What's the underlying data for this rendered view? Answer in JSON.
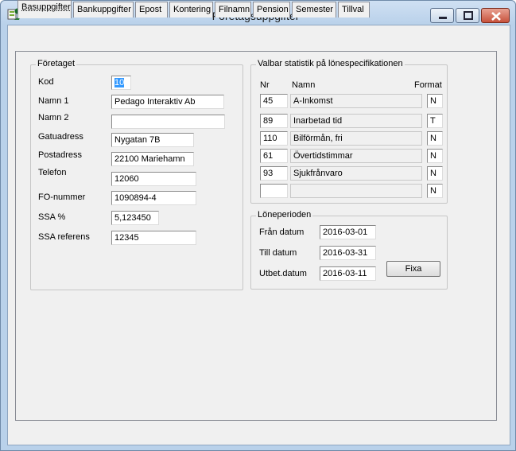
{
  "window": {
    "title": "Företagsuppgifter"
  },
  "tabs": [
    {
      "label": "Basuppgifter",
      "active": true
    },
    {
      "label": "Bankuppgifter"
    },
    {
      "label": "Epost"
    },
    {
      "label": "Kontering"
    },
    {
      "label": "Filnamn"
    },
    {
      "label": "Pension"
    },
    {
      "label": "Semester"
    },
    {
      "label": "Tillval"
    }
  ],
  "company": {
    "legend": "Företaget",
    "fields": [
      {
        "label": "Kod",
        "value": "10"
      },
      {
        "label": "Namn 1",
        "value": "Pedago Interaktiv Ab"
      },
      {
        "label": "Namn 2",
        "value": ""
      },
      {
        "label": "Gatuadress",
        "value": "Nygatan 7B"
      },
      {
        "label": "Postadress",
        "value": "22100  Mariehamn"
      },
      {
        "label": "Telefon",
        "value": "12060"
      },
      {
        "label": "FO-nummer",
        "value": "1090894-4"
      },
      {
        "label": "SSA %",
        "value": "5,123450"
      },
      {
        "label": "SSA referens",
        "value": "12345"
      }
    ]
  },
  "stats": {
    "legend": "Valbar statistik på lönespecifikationen",
    "col_nr": "Nr",
    "col_name": "Namn",
    "col_format": "Format",
    "rows": [
      {
        "nr": "45",
        "name": "A-Inkomst",
        "format": "N"
      },
      {
        "nr": "89",
        "name": "Inarbetad tid",
        "format": "T"
      },
      {
        "nr": "110",
        "name": "Bilförmån, fri",
        "format": "N"
      },
      {
        "nr": "61",
        "name": "Övertidstimmar",
        "format": "N"
      },
      {
        "nr": "93",
        "name": "Sjukfrånvaro",
        "format": "N"
      },
      {
        "nr": "",
        "name": "",
        "format": "N"
      }
    ]
  },
  "period": {
    "legend": "Löneperioden",
    "from_label": "Från datum",
    "from_value": "2016-03-01",
    "to_label": "Till datum",
    "to_value": "2016-03-31",
    "pay_label": "Utbet.datum",
    "pay_value": "2016-03-11",
    "fix_button": "Fixa"
  }
}
